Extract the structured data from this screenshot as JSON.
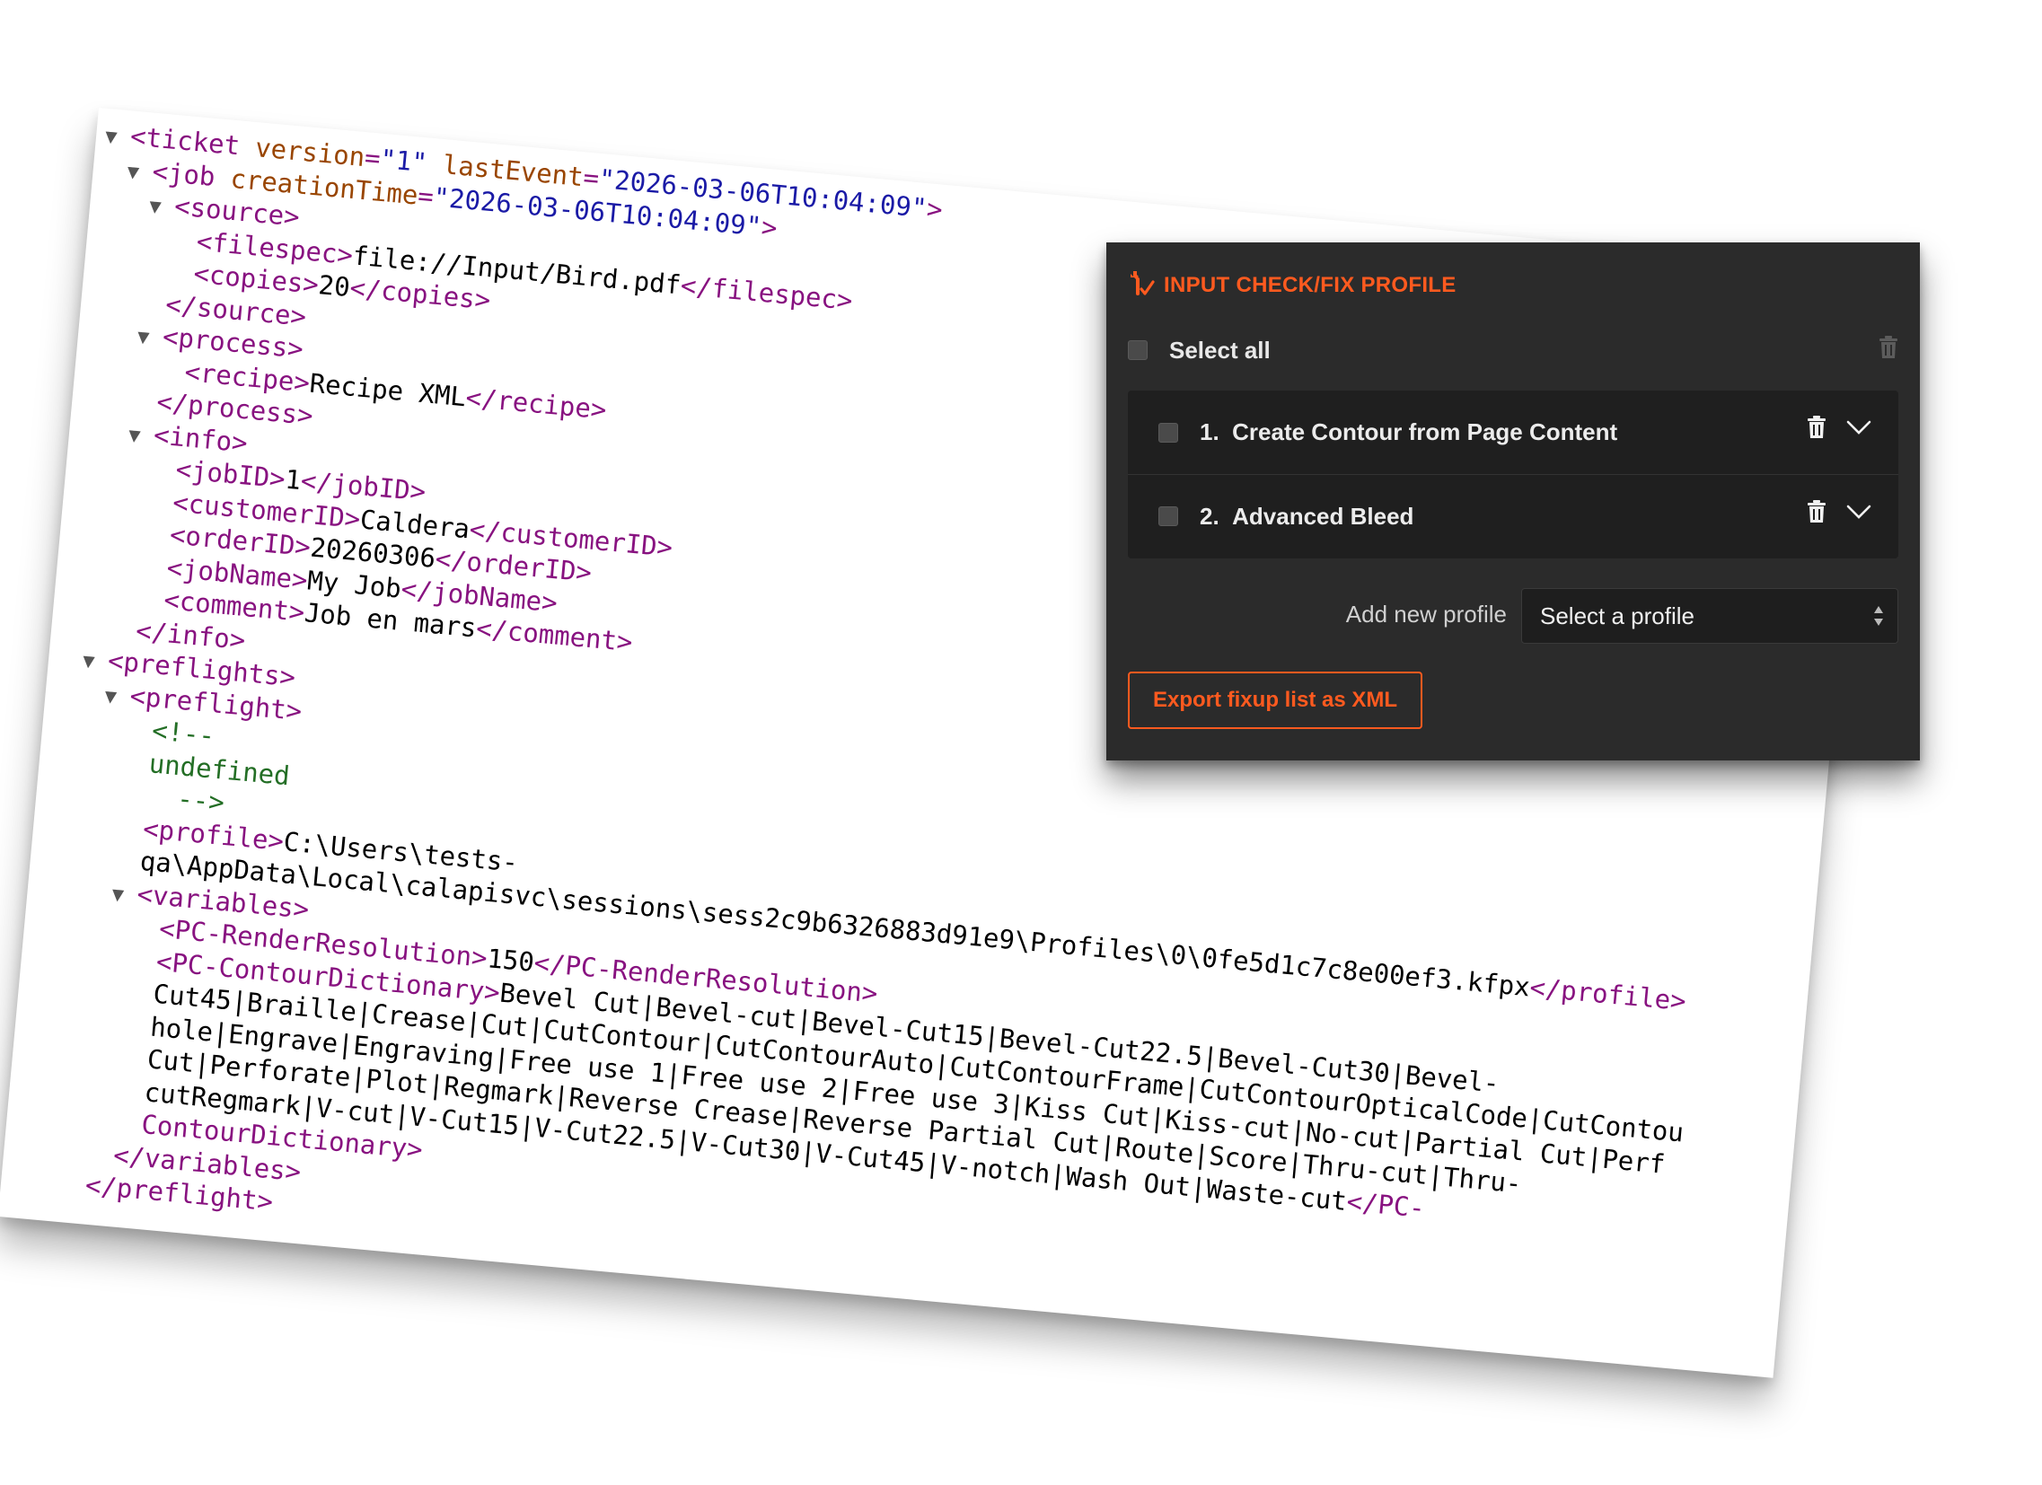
{
  "xml": {
    "lines": [
      {
        "indent": 0,
        "tri": true,
        "parts": [
          [
            "tg",
            "<ticket "
          ],
          [
            "at",
            "version"
          ],
          [
            "tg",
            "="
          ],
          [
            "av",
            "\"1\""
          ],
          [
            "tg",
            " "
          ],
          [
            "at",
            "lastEvent"
          ],
          [
            "tg",
            "="
          ],
          [
            "av",
            "\"2026-03-06T10:04:09\""
          ],
          [
            "tg",
            ">"
          ]
        ]
      },
      {
        "indent": 1,
        "tri": true,
        "parts": [
          [
            "tg",
            "<job "
          ],
          [
            "at",
            "creationTime"
          ],
          [
            "tg",
            "="
          ],
          [
            "av",
            "\"2026-03-06T10:04:09\""
          ],
          [
            "tg",
            ">"
          ]
        ]
      },
      {
        "indent": 2,
        "tri": true,
        "parts": [
          [
            "tg",
            "<source>"
          ]
        ]
      },
      {
        "indent": 3,
        "tri": false,
        "parts": [
          [
            "tg",
            "<filespec>"
          ],
          [
            "tx",
            "file://Input/Bird.pdf"
          ],
          [
            "tg",
            "</filespec>"
          ]
        ]
      },
      {
        "indent": 3,
        "tri": false,
        "parts": [
          [
            "tg",
            "<copies>"
          ],
          [
            "tx",
            "20"
          ],
          [
            "tg",
            "</copies>"
          ]
        ]
      },
      {
        "indent": 2,
        "tri": false,
        "parts": [
          [
            "tg",
            "</source>"
          ]
        ]
      },
      {
        "indent": 2,
        "tri": true,
        "parts": [
          [
            "tg",
            "<process>"
          ]
        ]
      },
      {
        "indent": 3,
        "tri": false,
        "parts": [
          [
            "tg",
            "<recipe>"
          ],
          [
            "tx",
            "Recipe XML"
          ],
          [
            "tg",
            "</recipe>"
          ]
        ]
      },
      {
        "indent": 2,
        "tri": false,
        "parts": [
          [
            "tg",
            "</process>"
          ]
        ]
      },
      {
        "indent": 2,
        "tri": true,
        "parts": [
          [
            "tg",
            "<info>"
          ]
        ]
      },
      {
        "indent": 3,
        "tri": false,
        "parts": [
          [
            "tg",
            "<jobID>"
          ],
          [
            "tx",
            "1"
          ],
          [
            "tg",
            "</jobID>"
          ]
        ]
      },
      {
        "indent": 3,
        "tri": false,
        "parts": [
          [
            "tg",
            "<customerID>"
          ],
          [
            "tx",
            "Caldera"
          ],
          [
            "tg",
            "</customerID>"
          ]
        ]
      },
      {
        "indent": 3,
        "tri": false,
        "parts": [
          [
            "tg",
            "<orderID>"
          ],
          [
            "tx",
            "20260306"
          ],
          [
            "tg",
            "</orderID>"
          ]
        ]
      },
      {
        "indent": 3,
        "tri": false,
        "parts": [
          [
            "tg",
            "<jobName>"
          ],
          [
            "tx",
            "My Job"
          ],
          [
            "tg",
            "</jobName>"
          ]
        ]
      },
      {
        "indent": 3,
        "tri": false,
        "parts": [
          [
            "tg",
            "<comment>"
          ],
          [
            "tx",
            "Job en mars"
          ],
          [
            "tg",
            "</comment>"
          ]
        ]
      },
      {
        "indent": 2,
        "tri": false,
        "parts": [
          [
            "tg",
            "</info>"
          ]
        ]
      },
      {
        "indent": 1,
        "tri": true,
        "parts": [
          [
            "tg",
            "<preflights>"
          ]
        ]
      },
      {
        "indent": 2,
        "tri": true,
        "parts": [
          [
            "tg",
            "<preflight>"
          ]
        ]
      },
      {
        "indent": 3,
        "tri": false,
        "parts": [
          [
            "cm",
            "<!--"
          ]
        ]
      },
      {
        "indent": 3,
        "tri": false,
        "parts": [
          [
            "cm",
            "undefined"
          ]
        ]
      },
      {
        "indent": 3,
        "tri": false,
        "parts": [
          [
            "cm",
            "  -->"
          ]
        ]
      },
      {
        "indent": 3,
        "tri": false,
        "parts": [
          [
            "tg",
            "<profile>"
          ],
          [
            "tx",
            "C:\\Users\\tests-"
          ]
        ]
      },
      {
        "indent": 3,
        "tri": false,
        "parts": [
          [
            "tx",
            "qa\\AppData\\Local\\calapisvc\\sessions\\sess2c9b6326883d91e9\\Profiles\\0\\0fe5d1c7c8e00ef3.kfpx"
          ],
          [
            "tg",
            "</profile>"
          ]
        ]
      },
      {
        "indent": 3,
        "tri": true,
        "parts": [
          [
            "tg",
            "<variables>"
          ]
        ]
      },
      {
        "indent": 4,
        "tri": false,
        "parts": [
          [
            "tg",
            "<PC-RenderResolution>"
          ],
          [
            "tx",
            "150"
          ],
          [
            "tg",
            "</PC-RenderResolution>"
          ]
        ]
      },
      {
        "indent": 4,
        "tri": false,
        "parts": [
          [
            "tg",
            "<PC-ContourDictionary>"
          ],
          [
            "tx",
            "Bevel Cut|Bevel-cut|Bevel-Cut15|Bevel-Cut22.5|Bevel-Cut30|Bevel-"
          ]
        ]
      },
      {
        "indent": 4,
        "tri": false,
        "parts": [
          [
            "tx",
            "Cut45|Braille|Crease|Cut|CutContour|CutContourAuto|CutContourFrame|CutContourOpticalCode|CutContou"
          ]
        ]
      },
      {
        "indent": 4,
        "tri": false,
        "parts": [
          [
            "tx",
            "hole|Engrave|Engraving|Free use 1|Free use 2|Free use 3|Kiss Cut|Kiss-cut|No-cut|Partial Cut|Perf"
          ]
        ]
      },
      {
        "indent": 4,
        "tri": false,
        "parts": [
          [
            "tx",
            "Cut|Perforate|Plot|Regmark|Reverse Crease|Reverse Partial Cut|Route|Score|Thru-cut|Thru-"
          ]
        ]
      },
      {
        "indent": 4,
        "tri": false,
        "parts": [
          [
            "tx",
            "cutRegmark|V-cut|V-Cut15|V-Cut22.5|V-Cut30|V-Cut45|V-notch|Wash Out|Waste-cut"
          ],
          [
            "tg",
            "</PC-"
          ]
        ]
      },
      {
        "indent": 4,
        "tri": false,
        "parts": [
          [
            "tg",
            "ContourDictionary>"
          ]
        ]
      },
      {
        "indent": 3,
        "tri": false,
        "parts": [
          [
            "tg",
            "</variables>"
          ]
        ]
      },
      {
        "indent": 2,
        "tri": false,
        "parts": [
          [
            "tg",
            "</preflight>"
          ]
        ]
      }
    ]
  },
  "panel": {
    "title": "INPUT CHECK/FIX PROFILE",
    "title_icon": "wrench-check-icon",
    "select_all_label": "Select all",
    "items": [
      {
        "number": "1.",
        "label": "Create Contour from Page Content"
      },
      {
        "number": "2.",
        "label": "Advanced Bleed"
      }
    ],
    "add_profile_label": "Add new profile",
    "profile_select_value": "Select a profile",
    "export_button_label": "Export fixup list as XML"
  },
  "colors": {
    "accent": "#ff5a1f",
    "panel_bg": "#2b2b2b",
    "list_bg": "#1f1f1f",
    "xml_tag": "#881280",
    "xml_attr": "#994500",
    "xml_value": "#1a1aa6",
    "xml_comment": "#236e25"
  }
}
